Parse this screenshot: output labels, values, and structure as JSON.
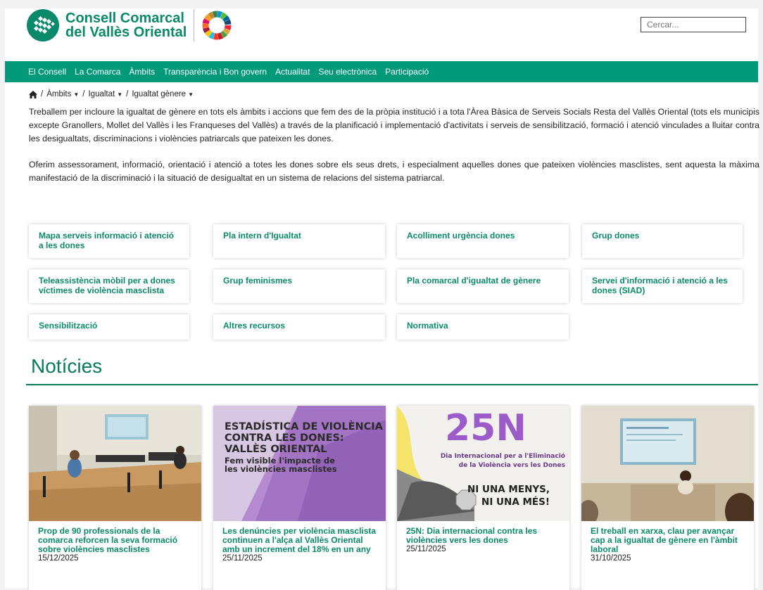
{
  "header": {
    "logo_line1": "Consell Comarcal",
    "logo_line2": "del Vallès Oriental",
    "search_placeholder": "Cercar..."
  },
  "nav": {
    "items": [
      "El Consell",
      "La Comarca",
      "Àmbits",
      "Transparència i Bon govern",
      "Actualitat",
      "Seu electrònica",
      "Participació"
    ]
  },
  "breadcrumb": {
    "items": [
      "Àmbits",
      "Igualtat",
      "Igualtat gènere"
    ]
  },
  "intro": {
    "p1": "Treballem per incloure la igualtat de gènere en tots els àmbits i accions que fem des de la pròpia institució i a tota l'Àrea Bàsica de Serveis Socials Resta del Vallès Oriental (tots els municipis excepte Granollers, Mollet del Vallès i les Franqueses del Vallès) a través de la planificació i implementació d'activitats i serveis de sensibilització, formació i atenció vinculades a lluitar contra les desigualtats, discriminacions i violències patriarcals que pateixen les dones.",
    "p2": "Oferim assessorament, informació, orientació i atenció a totes les dones sobre els seus drets, i especialment aquelles dones que pateixen violències masclistes, sent aquesta la màxima manifestació de la discriminació i la situació de desigualtat en un sistema de relacions del sistema patriarcal."
  },
  "cards": [
    "Mapa serveis informació i atenció a les dones",
    "Pla intern d'Igualtat",
    "Acolliment urgència dones",
    "Grup dones",
    "Teleassistència mòbil per a dones víctimes de violència masclista",
    "Grup feminismes",
    "Pla comarcal d'igualtat de gènere",
    "Servei d'informació i atenció a les dones (SIAD)",
    "Sensibilització",
    "Altres recursos",
    "Normativa"
  ],
  "news": {
    "heading": "Notícies",
    "items": [
      {
        "title": "Prop de 90 professionals de la comarca reforcen la seva formació sobre violències masclistes",
        "date": "15/12/2025"
      },
      {
        "title": "Les denúncies per violència masclista continuen a l'alça al Vallès Oriental amb un increment del 18% en un any",
        "date": "25/11/2025"
      },
      {
        "title": "25N: Dia internacional contra les violències vers les dones",
        "date": "25/11/2025"
      },
      {
        "title": "El treball en xarxa, clau per avançar cap a la igualtat de gènere en l'àmbit laboral",
        "date": "31/10/2025"
      }
    ],
    "img2": {
      "line1": "ESTADÍSTICA DE VIOLÈNCIA",
      "line2": "CONTRA LES DONES:",
      "line3": "VALLÈS ORIENTAL",
      "sub1": "Fem visible l'impacte de",
      "sub2": "les violències masclistes"
    },
    "img3": {
      "big": "25N",
      "line1": "Dia Internacional per a l'Eliminació",
      "line2": "de la Violència vers les Dones",
      "slogan1": "NI UNA MENYS,",
      "slogan2": "NI UNA MÉS!"
    }
  },
  "colors": {
    "brand_green": "#00997a",
    "link_green": "#0a8a6a",
    "purple": "#8e5fb5"
  }
}
